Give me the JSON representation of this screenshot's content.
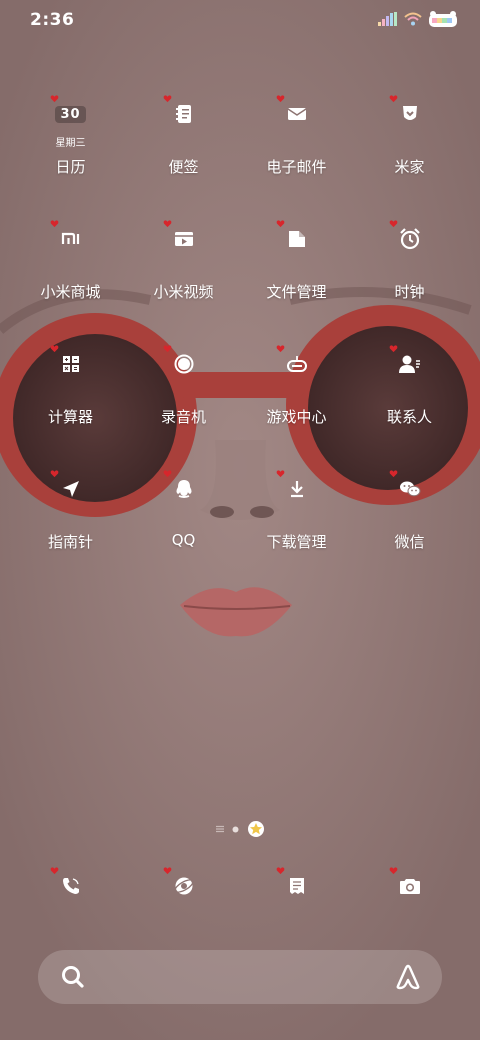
{
  "status": {
    "time": "2:36"
  },
  "apps": [
    {
      "label": "日历",
      "icon": "calendar-icon",
      "date_number": "30",
      "weekday": "星期三"
    },
    {
      "label": "便签",
      "icon": "notes-icon"
    },
    {
      "label": "电子邮件",
      "icon": "mail-icon"
    },
    {
      "label": "米家",
      "icon": "mijia-icon"
    },
    {
      "label": "小米商城",
      "icon": "mi-store-icon"
    },
    {
      "label": "小米视频",
      "icon": "video-icon"
    },
    {
      "label": "文件管理",
      "icon": "file-manager-icon"
    },
    {
      "label": "时钟",
      "icon": "clock-icon"
    },
    {
      "label": "计算器",
      "icon": "calculator-icon"
    },
    {
      "label": "录音机",
      "icon": "recorder-icon"
    },
    {
      "label": "游戏中心",
      "icon": "game-center-icon"
    },
    {
      "label": "联系人",
      "icon": "contacts-icon"
    },
    {
      "label": "指南针",
      "icon": "compass-icon"
    },
    {
      "label": "QQ",
      "icon": "qq-icon"
    },
    {
      "label": "下载管理",
      "icon": "download-icon"
    },
    {
      "label": "微信",
      "icon": "wechat-icon"
    }
  ],
  "dock": [
    {
      "icon": "phone-icon"
    },
    {
      "icon": "browser-icon"
    },
    {
      "icon": "messages-icon"
    },
    {
      "icon": "camera-icon"
    }
  ],
  "colors": {
    "heart": "#d7262c",
    "wallpaper": "#8d7472",
    "glasses": "#b8453f"
  }
}
